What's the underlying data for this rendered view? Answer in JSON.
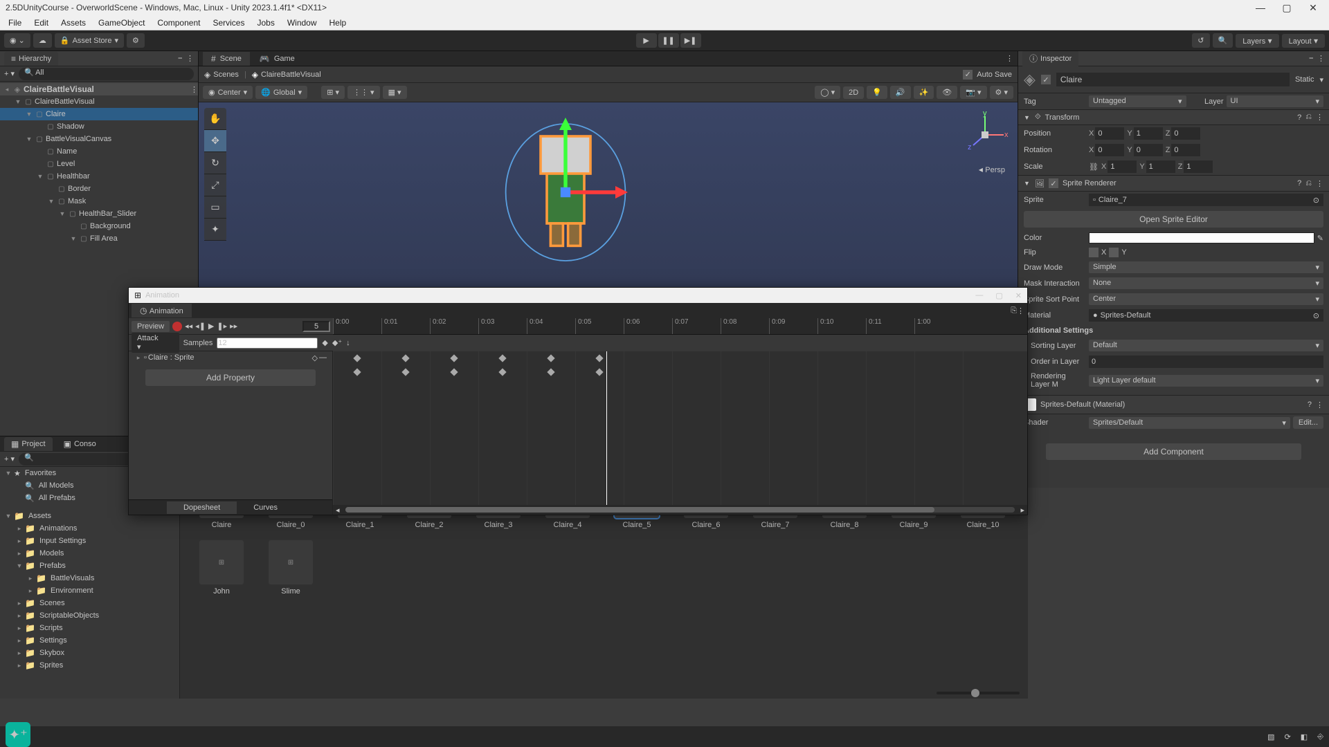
{
  "titlebar": {
    "text": "2.5DUnityCourse - OverworldScene - Windows, Mac, Linux - Unity 2023.1.4f1* <DX11>"
  },
  "menu": [
    "File",
    "Edit",
    "Assets",
    "GameObject",
    "Component",
    "Services",
    "Jobs",
    "Window",
    "Help"
  ],
  "top_toolbar": {
    "asset_store": "Asset Store",
    "layers": "Layers",
    "layout": "Layout"
  },
  "hierarchy": {
    "title": "Hierarchy",
    "search_placeholder": "All",
    "root": "ClaireBattleVisual",
    "items": [
      {
        "l": 1,
        "name": "ClaireBattleVisual",
        "exp": true,
        "prefab": true
      },
      {
        "l": 2,
        "name": "Claire",
        "exp": true,
        "prefab": true,
        "selected": true
      },
      {
        "l": 3,
        "name": "Shadow",
        "prefab": true
      },
      {
        "l": 2,
        "name": "BattleVisualCanvas",
        "exp": true,
        "prefab": true
      },
      {
        "l": 3,
        "name": "Name",
        "prefab": true
      },
      {
        "l": 3,
        "name": "Level",
        "prefab": true
      },
      {
        "l": 3,
        "name": "Healthbar",
        "exp": true,
        "prefab": true
      },
      {
        "l": 4,
        "name": "Border",
        "prefab": true
      },
      {
        "l": 4,
        "name": "Mask",
        "exp": true,
        "prefab": true
      },
      {
        "l": 5,
        "name": "HealthBar_Slider",
        "exp": true,
        "prefab": true
      },
      {
        "l": 6,
        "name": "Background",
        "prefab": true
      },
      {
        "l": 6,
        "name": "Fill Area",
        "exp": true,
        "prefab": true
      }
    ]
  },
  "scene": {
    "tab_scene": "Scene",
    "tab_game": "Game",
    "crumb_scenes": "Scenes",
    "crumb_current": "ClaireBattleVisual",
    "auto_save": "Auto Save",
    "pivot": "Center",
    "space": "Global",
    "mode_2d": "2D",
    "persp": "Persp"
  },
  "inspector": {
    "title": "Inspector",
    "object_name": "Claire",
    "static_label": "Static",
    "tag_label": "Tag",
    "tag_value": "Untagged",
    "layer_label": "Layer",
    "layer_value": "UI",
    "transform": {
      "title": "Transform",
      "position_label": "Position",
      "px": "0",
      "py": "1",
      "pz": "0",
      "rotation_label": "Rotation",
      "rx": "0",
      "ry": "0",
      "rz": "0",
      "scale_label": "Scale",
      "sx": "1",
      "sy": "1",
      "sz": "1"
    },
    "sprite_renderer": {
      "title": "Sprite Renderer",
      "sprite_label": "Sprite",
      "sprite_value": "Claire_7",
      "open_editor": "Open Sprite Editor",
      "color_label": "Color",
      "flip_label": "Flip",
      "flip_x": "X",
      "flip_y": "Y",
      "draw_mode_label": "Draw Mode",
      "draw_mode_value": "Simple",
      "mask_label": "Mask Interaction",
      "mask_value": "None",
      "sort_point_label": "Sprite Sort Point",
      "sort_point_value": "Center",
      "material_label": "Material",
      "material_value": "Sprites-Default",
      "add_settings": "Additional Settings",
      "sorting_layer_label": "Sorting Layer",
      "sorting_layer_value": "Default",
      "order_label": "Order in Layer",
      "order_value": "0",
      "render_mask_label": "Rendering Layer M",
      "render_mask_value": "Light Layer default",
      "mat_title": "Sprites-Default (Material)",
      "shader_label": "Shader",
      "shader_value": "Sprites/Default",
      "edit_btn": "Edit..."
    },
    "add_component": "Add Component"
  },
  "animation": {
    "window_title": "Animation",
    "tab": "Animation",
    "preview": "Preview",
    "frame": "5",
    "clip": "Attack",
    "samples_label": "Samples",
    "samples_value": "12",
    "property_row": "Claire : Sprite",
    "add_property": "Add Property",
    "dopesheet": "Dopesheet",
    "curves": "Curves",
    "ticks": [
      "0:00",
      "0:01",
      "0:02",
      "0:03",
      "0:04",
      "0:05",
      "0:06",
      "0:07",
      "0:08",
      "0:09",
      "0:10",
      "0:11",
      "1:00"
    ],
    "keyframe_positions": [
      35,
      105,
      175,
      245,
      315,
      385
    ]
  },
  "project": {
    "title": "Project",
    "console": "Conso",
    "favorites": [
      {
        "l": 0,
        "name": "Favorites",
        "type": "header"
      },
      {
        "l": 1,
        "name": "All Models",
        "type": "search"
      },
      {
        "l": 1,
        "name": "All Prefabs",
        "type": "search"
      }
    ],
    "folders": [
      {
        "l": 0,
        "name": "Assets",
        "exp": true
      },
      {
        "l": 1,
        "name": "Animations"
      },
      {
        "l": 1,
        "name": "Input Settings"
      },
      {
        "l": 1,
        "name": "Models"
      },
      {
        "l": 1,
        "name": "Prefabs",
        "exp": true
      },
      {
        "l": 2,
        "name": "BattleVisuals"
      },
      {
        "l": 2,
        "name": "Environment"
      },
      {
        "l": 1,
        "name": "Scenes"
      },
      {
        "l": 1,
        "name": "ScriptableObjects"
      },
      {
        "l": 1,
        "name": "Scripts"
      },
      {
        "l": 1,
        "name": "Settings"
      },
      {
        "l": 1,
        "name": "Skybox"
      },
      {
        "l": 1,
        "name": "Sprites"
      }
    ],
    "assets_row1": [
      "Claire",
      "Claire_0",
      "Claire_1",
      "Claire_2",
      "Claire_3",
      "Claire_4",
      "Claire_5",
      "Claire_6",
      "Claire_7",
      "Claire_8",
      "Claire_9",
      "Claire_10"
    ],
    "assets_row2": [
      "John",
      "Slime"
    ]
  }
}
